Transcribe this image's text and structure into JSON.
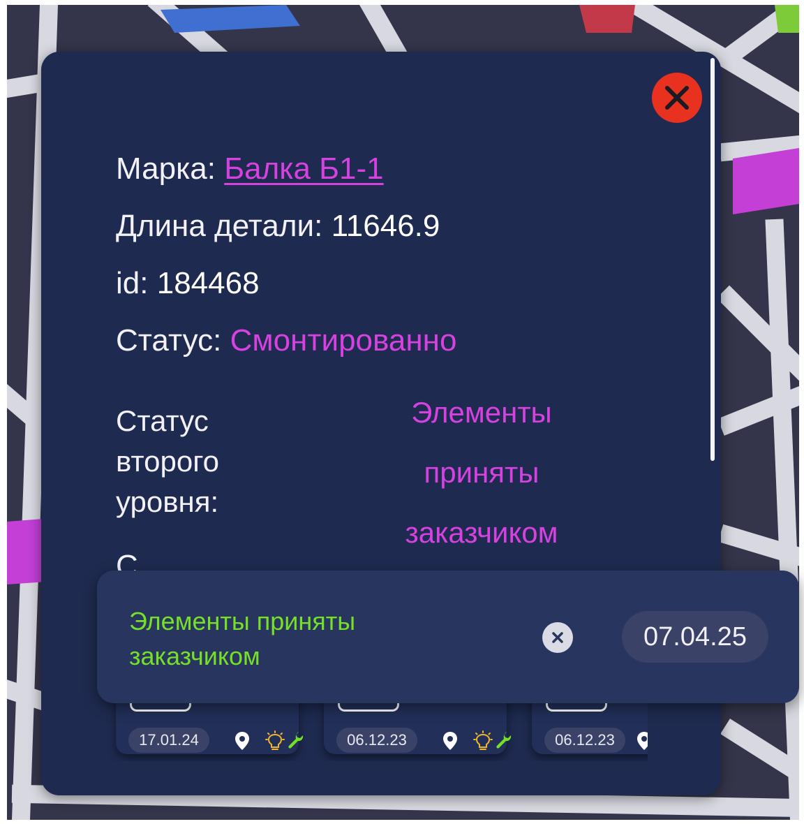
{
  "details": {
    "mark_label": "Марка:",
    "mark_value": "Балка Б1-1",
    "length_label": "Длина детали:",
    "length_value": "11646.9",
    "id_label": "id:",
    "id_value": "184468",
    "status_label": "Статус:",
    "status_value": "Смонтированно",
    "second_status_label": "Статус второго уровня:",
    "second_status_value": "Элементы приняты заказчиком",
    "partial_text": "С"
  },
  "cards": [
    {
      "date": "17.01.24"
    },
    {
      "date": "06.12.23"
    },
    {
      "date": "06.12.23"
    }
  ],
  "toast": {
    "message": "Элементы приняты заказчиком",
    "date": "07.04.25"
  },
  "icons": {
    "close": "close-icon",
    "location": "location-pin-icon",
    "bulb": "lightbulb-icon",
    "wrench": "wrench-icon",
    "dismiss": "dismiss-icon"
  },
  "colors": {
    "panel_bg": "#1e2a50",
    "accent_magenta": "#d542df",
    "accent_green": "#76e028",
    "close_red": "#e8321f",
    "bulb_amber": "#f2b52e"
  }
}
